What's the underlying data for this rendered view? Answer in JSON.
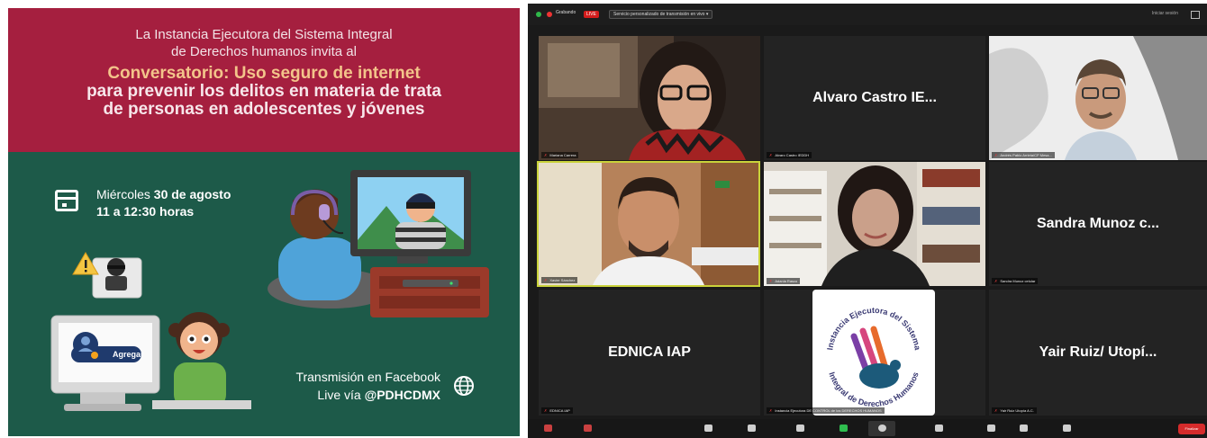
{
  "poster": {
    "intro_line1": "La Instancia Ejecutora del Sistema Integral",
    "intro_line2": "de Derechos humanos invita al",
    "title_line1": "Conversatorio: Uso seguro de internet",
    "title_line2": "para prevenir los delitos en materia de trata",
    "title_line3": "de personas en adolescentes y jóvenes",
    "date_prefix": "Miércoles ",
    "date_bold": "30 de agosto",
    "time": "11 a 12:30 horas",
    "agregar_label": "Agregar",
    "stream_line1": "Transmisión en Facebook",
    "stream_line2_prefix": "Live vía ",
    "stream_handle": "@PDHCDMX",
    "colors": {
      "top": "#a51f3f",
      "bottom": "#1d5a49",
      "title_accent": "#f3c48a"
    }
  },
  "zoom": {
    "topbar": {
      "recording_label": "Grabando",
      "live_label": "LIVE",
      "stream_service": "Servicio personalizado de transmisión en vivo",
      "exit_label": "Iniciar sesión"
    },
    "tiles": [
      {
        "display_name": "",
        "tag": "Mariana Carrera"
      },
      {
        "display_name": "Alvaro Castro IE...",
        "tag": "Alvaro Castro IEDDH"
      },
      {
        "display_name": "",
        "tag": "Andrés Pablo Arrieta/CP Mesa..."
      },
      {
        "display_name": "",
        "tag": "Xavier Sánchez"
      },
      {
        "display_name": "",
        "tag": "Adanla Rasco"
      },
      {
        "display_name": "Sandra Munoz c...",
        "tag": "Sandra Munoz celular"
      },
      {
        "display_name": "EDNICA IAP",
        "tag": "EDNICA IAP"
      },
      {
        "display_name": "",
        "tag": "Instancia Ejecutora DE CONTROL de los DERECHOS HUMANOS"
      },
      {
        "display_name": "Yair Ruiz/ Utopí...",
        "tag": "Yair Ruiz Utopía A.C."
      }
    ],
    "logo_text": {
      "top": "Instancia Ejecutora del Sistema",
      "bottom": "Integral de Derechos Humanos"
    },
    "end_label": "Finalizar",
    "colors": {
      "active_speaker_border": "#c9d23a",
      "live_red": "#d31c1c"
    }
  }
}
